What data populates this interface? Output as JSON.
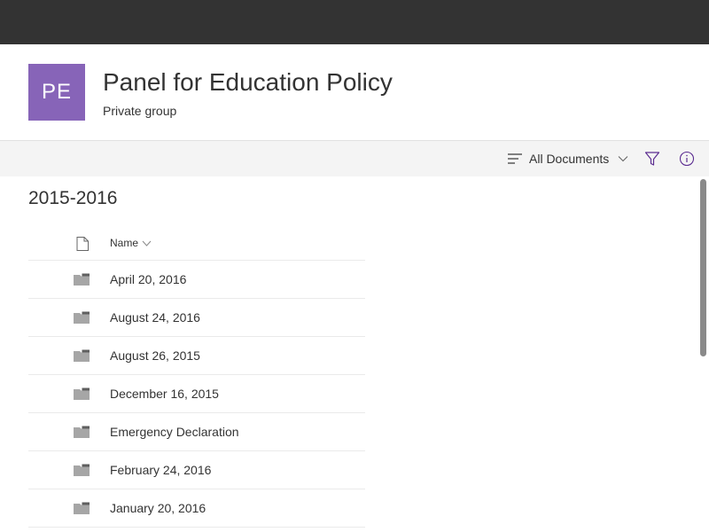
{
  "colors": {
    "avatar_bg": "#8764b8",
    "accent": "#5c2d91",
    "topbar": "#333333",
    "commandbar": "#f4f4f4"
  },
  "group": {
    "avatar_initials": "PE",
    "title": "Panel for Education Policy",
    "subtitle": "Private group"
  },
  "commandbar": {
    "view_icon": "list-lines-icon",
    "view_label": "All Documents",
    "view_chevron_icon": "chevron-down-icon",
    "filter_icon": "filter-icon",
    "info_icon": "info-icon"
  },
  "library": {
    "folder_title": "2015-2016",
    "columns": {
      "type_icon": "document-icon",
      "name_label": "Name",
      "sort_icon": "chevron-down-icon"
    },
    "rows": [
      {
        "name": "April 20, 2016",
        "icon": "folder-icon"
      },
      {
        "name": "August 24, 2016",
        "icon": "folder-icon"
      },
      {
        "name": "August 26, 2015",
        "icon": "folder-icon"
      },
      {
        "name": "December 16, 2015",
        "icon": "folder-icon"
      },
      {
        "name": "Emergency Declaration",
        "icon": "folder-icon"
      },
      {
        "name": "February 24, 2016",
        "icon": "folder-icon"
      },
      {
        "name": "January 20, 2016",
        "icon": "folder-icon"
      }
    ]
  }
}
